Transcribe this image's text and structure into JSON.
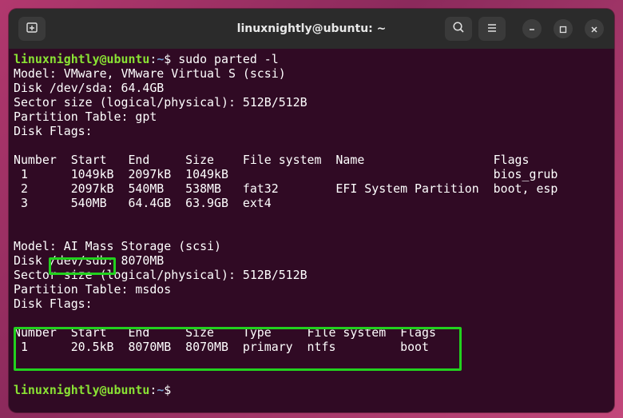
{
  "window": {
    "title": "linuxnightly@ubuntu: ~",
    "buttons": {
      "new_tab_icon": "new-tab-icon",
      "search_icon": "search-icon",
      "menu_icon": "hamburger-menu-icon",
      "minimize_icon": "minimize-icon",
      "maximize_icon": "maximize-icon",
      "close_icon": "close-icon"
    }
  },
  "prompt": {
    "user_host": "linuxnightly@ubuntu",
    "separator": ":",
    "path": "~",
    "dollar": "$",
    "command": " sudo parted -l"
  },
  "output": [
    "Model: VMware, VMware Virtual S (scsi)",
    "Disk /dev/sda: 64.4GB",
    "Sector size (logical/physical): 512B/512B",
    "Partition Table: gpt",
    "Disk Flags:",
    "",
    "Number  Start   End     Size    File system  Name                  Flags",
    " 1      1049kB  2097kB  1049kB                                     bios_grub",
    " 2      2097kB  540MB   538MB   fat32        EFI System Partition  boot, esp",
    " 3      540MB   64.4GB  63.9GB  ext4",
    "",
    "",
    "Model: AI Mass Storage (scsi)",
    "Disk /dev/sdb: 8070MB",
    "Sector size (logical/physical): 512B/512B",
    "Partition Table: msdos",
    "Disk Flags:",
    "",
    "Number  Start   End     Size    Type     File system  Flags",
    " 1      20.5kB  8070MB  8070MB  primary  ntfs         boot",
    ""
  ],
  "final_prompt": {
    "user_host": "linuxnightly@ubuntu",
    "separator": ":",
    "path": "~",
    "dollar": "$"
  },
  "colors": {
    "terminal_bg": "#300a24",
    "prompt_user": "#8ae234",
    "prompt_path": "#729fcf",
    "highlight": "#22d11e"
  }
}
